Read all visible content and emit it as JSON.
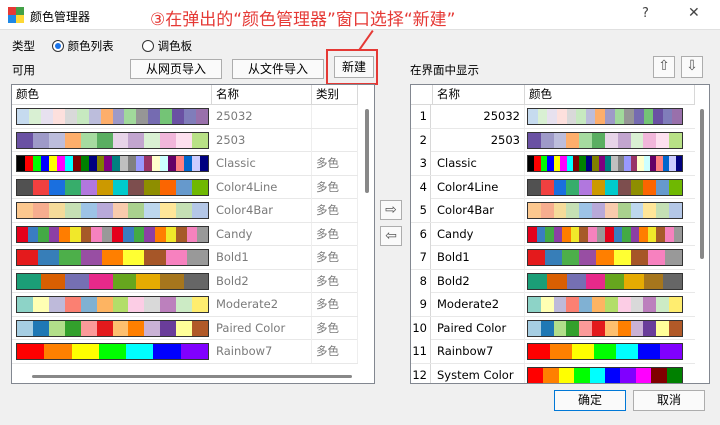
{
  "window": {
    "title": "颜色管理器",
    "help": "?",
    "close": "✕"
  },
  "annotation": "③在弹出的“颜色管理器”窗口选择“新建”",
  "type_label": "类型",
  "radio_list": "颜色列表",
  "radio_palette": "调色板",
  "available_label": "可用",
  "btn_web": "从网页导入",
  "btn_file": "从文件导入",
  "btn_new": "新建",
  "display_label": "在界面中显示",
  "left_headers": [
    "颜色",
    "名称",
    "类别"
  ],
  "right_headers": [
    "名称",
    "颜色"
  ],
  "ok": "确定",
  "cancel": "取消",
  "move_right_icon": "arrow-right-icon",
  "move_left_icon": "arrow-left-icon",
  "move_up_icon": "arrow-up-icon",
  "move_down_icon": "arrow-down-icon",
  "rows": [
    {
      "name": "25032",
      "cat": "",
      "colors": [
        "#c6dbef",
        "#d9f0d3",
        "#e7e1ef",
        "#fde0dd",
        "#d9d9d9",
        "#c7e9c0",
        "#bcbddc",
        "#fdae6b",
        "#9e9ac8",
        "#a1d99b",
        "#969696",
        "#756bb1",
        "#74c476",
        "#6a51a3",
        "#807dba",
        "#9970ab"
      ]
    },
    {
      "name": "2503",
      "cat": "",
      "colors": [
        "#6a51a3",
        "#9e9ac8",
        "#bcbddc",
        "#fdae6b",
        "#a6dba0",
        "#5aae61",
        "#e7d4e8",
        "#c2a5cf",
        "#d9f0d3",
        "#f1b6da",
        "#fde0ef",
        "#b8e186"
      ]
    },
    {
      "name": "Classic",
      "cat": "多色",
      "colors": [
        "#000000",
        "#ff0000",
        "#00ff00",
        "#0000ff",
        "#ffff00",
        "#ff00ff",
        "#00ffff",
        "#800000",
        "#008000",
        "#000080",
        "#808000",
        "#800080",
        "#008080",
        "#c0c0c0",
        "#808080",
        "#9999ff",
        "#993366",
        "#ffffcc",
        "#ccffff",
        "#660066",
        "#ff8080",
        "#0066cc",
        "#ccccff",
        "#000080"
      ]
    },
    {
      "name": "Color4Line",
      "cat": "多色",
      "colors": [
        "#515151",
        "#f14040",
        "#1a6fdf",
        "#37ad6b",
        "#b177de",
        "#cc9900",
        "#00cbcc",
        "#7d4e4e",
        "#8e8e00",
        "#fb6501",
        "#6699cc",
        "#6fb802"
      ]
    },
    {
      "name": "Color4Bar",
      "cat": "多色",
      "colors": [
        "#fcc88f",
        "#f6ad8f",
        "#f5db9a",
        "#c6e0b4",
        "#9dc3e6",
        "#b8a9d9",
        "#f8cbad",
        "#a9d18e",
        "#bdd7ee",
        "#ffe699",
        "#c5e0b4",
        "#b4c7e7"
      ]
    },
    {
      "name": "Candy",
      "cat": "多色",
      "colors": [
        "#e4001c",
        "#3a7dc1",
        "#43aa45",
        "#8c3fa5",
        "#ff7d00",
        "#f1e82a",
        "#a65a28",
        "#f582be",
        "#999999",
        "#e4001c",
        "#3a7dc1",
        "#43aa45",
        "#8c3fa5",
        "#ff7d00",
        "#f1e82a",
        "#a65a28",
        "#f582be",
        "#999999"
      ]
    },
    {
      "name": "Bold1",
      "cat": "多色",
      "colors": [
        "#e41a1c",
        "#377eb8",
        "#4daf4a",
        "#984ea3",
        "#ff7f00",
        "#ffff33",
        "#a65628",
        "#f781bf",
        "#999999"
      ]
    },
    {
      "name": "Bold2",
      "cat": "多色",
      "colors": [
        "#1b9e77",
        "#d95f02",
        "#7570b3",
        "#e7298a",
        "#66a61e",
        "#e6ab02",
        "#a6761d",
        "#666666"
      ]
    },
    {
      "name": "Moderate2",
      "cat": "多色",
      "colors": [
        "#8dd3c7",
        "#ffffb3",
        "#bebada",
        "#fb8072",
        "#80b1d3",
        "#fdb462",
        "#b3de69",
        "#fccde5",
        "#d9d9d9",
        "#bc80bd",
        "#ccebc5",
        "#ffed6f"
      ]
    },
    {
      "name": "Paired Color",
      "cat": "多色",
      "colors": [
        "#a6cee3",
        "#1f78b4",
        "#b2df8a",
        "#33a02c",
        "#fb9a99",
        "#e31a1c",
        "#fdbf6f",
        "#ff7f00",
        "#cab2d6",
        "#6a3d9a",
        "#ffff99",
        "#b15928"
      ]
    },
    {
      "name": "Rainbow7",
      "cat": "多色",
      "colors": [
        "#ff0000",
        "#ff8000",
        "#ffff00",
        "#00ff00",
        "#00ffff",
        "#0000ff",
        "#8000ff"
      ]
    }
  ],
  "extra_row": {
    "name": "System Color List",
    "colors": [
      "#ff0000",
      "#ff8000",
      "#ffff00",
      "#00ff00",
      "#00ffff",
      "#0000ff",
      "#8000ff",
      "#ff00ff",
      "#800000",
      "#008000"
    ]
  }
}
